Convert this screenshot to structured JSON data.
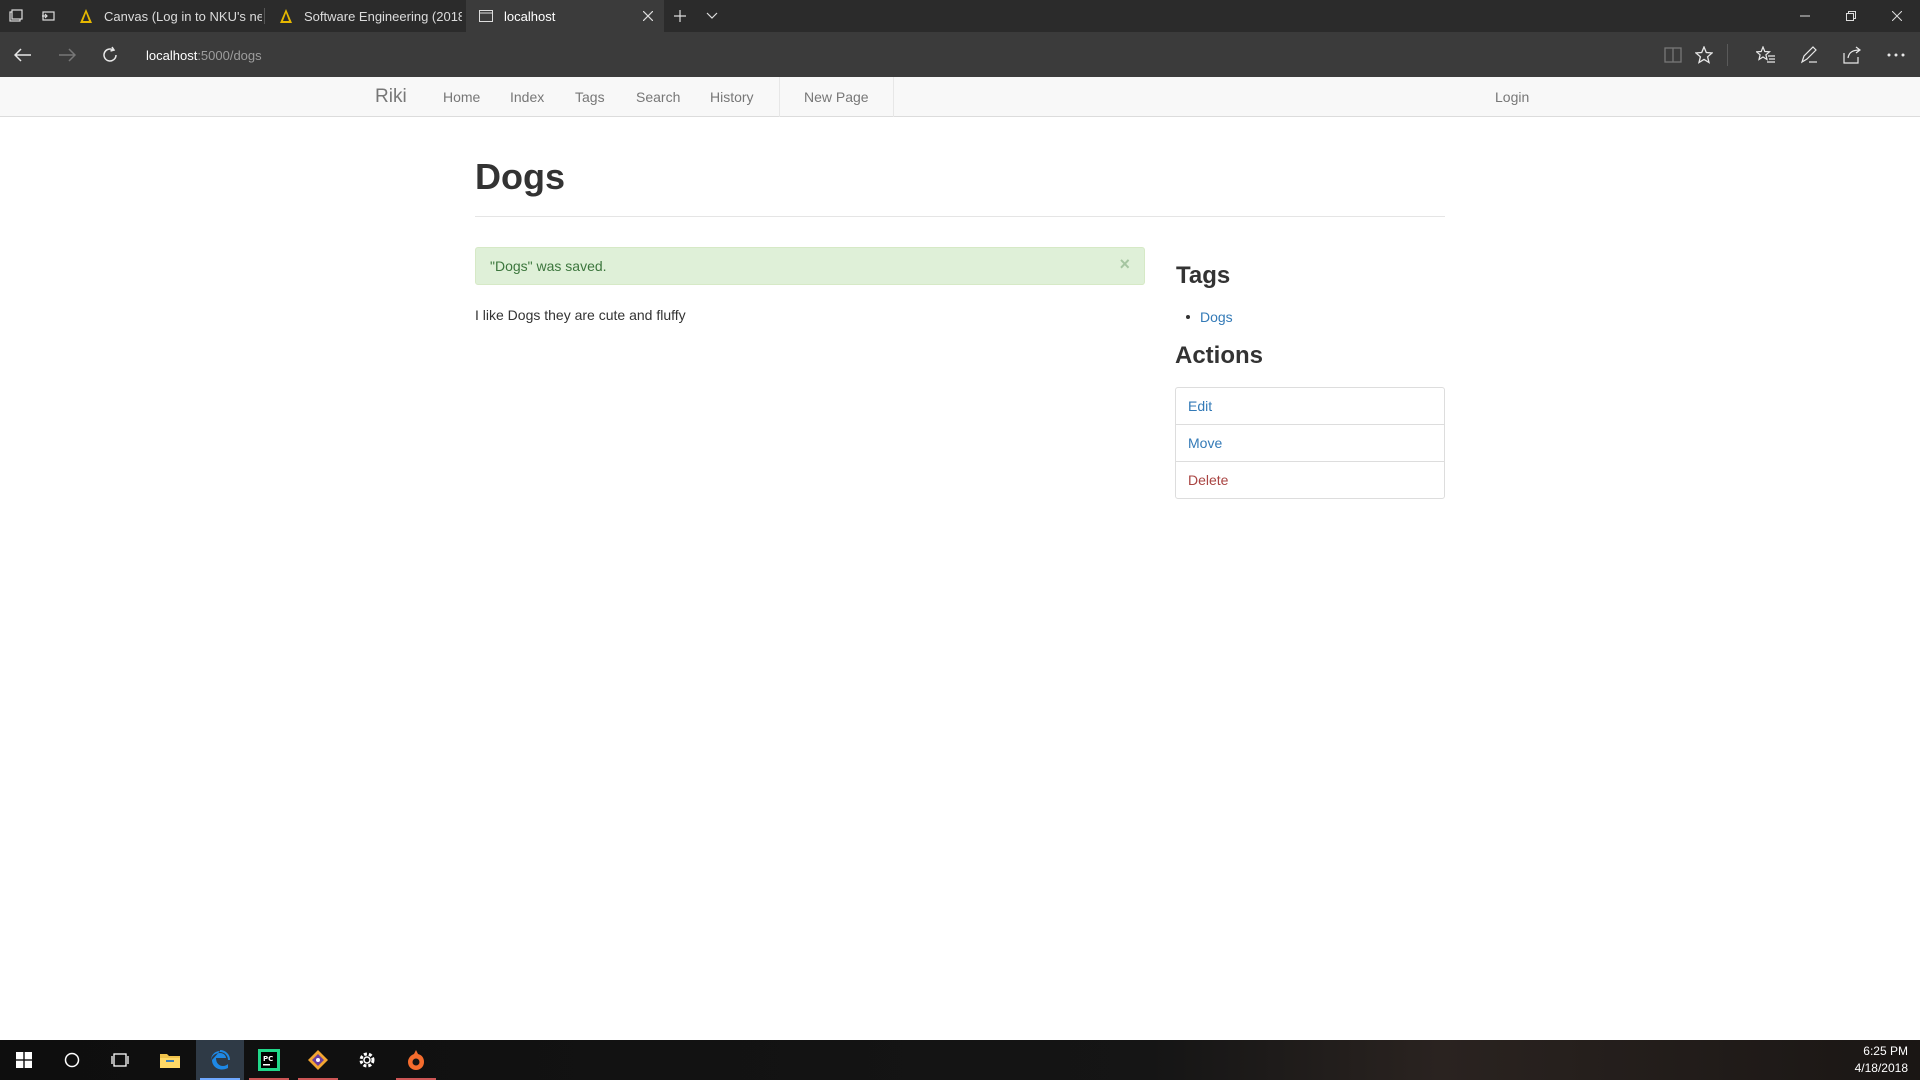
{
  "browser": {
    "tabs": [
      {
        "title": "Canvas (Log in to NKU's new",
        "active": false
      },
      {
        "title": "Software Engineering (2018",
        "active": false
      },
      {
        "title": "localhost",
        "active": true
      }
    ],
    "address": {
      "host": "localhost",
      "path": ":5000/dogs"
    }
  },
  "navbar": {
    "brand": "Riki",
    "links": [
      "Home",
      "Index",
      "Tags",
      "Search",
      "History"
    ],
    "new_page": "New Page",
    "login": "Login"
  },
  "page": {
    "title": "Dogs",
    "alert": "\"Dogs\" was saved.",
    "alert_close": "×",
    "body": "I like Dogs they are cute and fluffy"
  },
  "sidebar": {
    "tags_heading": "Tags",
    "tags": [
      "Dogs"
    ],
    "actions_heading": "Actions",
    "actions": {
      "edit": "Edit",
      "move": "Move",
      "delete": "Delete"
    }
  },
  "taskbar": {
    "time": "6:25 PM",
    "date": "4/18/2018"
  },
  "colors": {
    "link": "#337ab7",
    "danger": "#a94442",
    "alert_bg": "#dff0d8",
    "alert_text": "#3c763d"
  }
}
